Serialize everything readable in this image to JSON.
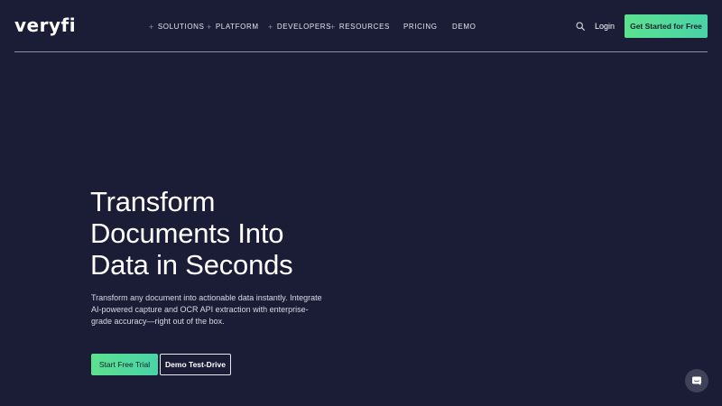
{
  "header": {
    "logo": "veryfi",
    "nav": [
      {
        "label": "SOLUTIONS",
        "has_plus": true
      },
      {
        "label": "PLATFORM",
        "has_plus": true
      },
      {
        "label": "DEVELOPERS",
        "has_plus": true
      },
      {
        "label": "RESOURCES",
        "has_plus": true
      },
      {
        "label": "PRICING",
        "has_plus": false
      },
      {
        "label": "DEMO",
        "has_plus": false
      }
    ],
    "plus_glyph": "+",
    "search_icon": "search-icon",
    "login": "Login",
    "cta": "Get Started for Free"
  },
  "hero": {
    "title_lines": [
      "Transform",
      "Documents Into",
      "Data in Seconds"
    ],
    "subtitle": "Transform any document into actionable data instantly. Integrate AI-powered capture and OCR API extraction with enterprise-grade accuracy—right out of the box.",
    "primary_button": "Start Free Trial",
    "secondary_button": "Demo Test-Drive"
  },
  "chat": {
    "icon": "chat-icon"
  },
  "colors": {
    "background": "#1b1d36",
    "accent_start": "#5ce18f",
    "accent_end": "#49d3a7",
    "divider": "#8b8fa6"
  }
}
